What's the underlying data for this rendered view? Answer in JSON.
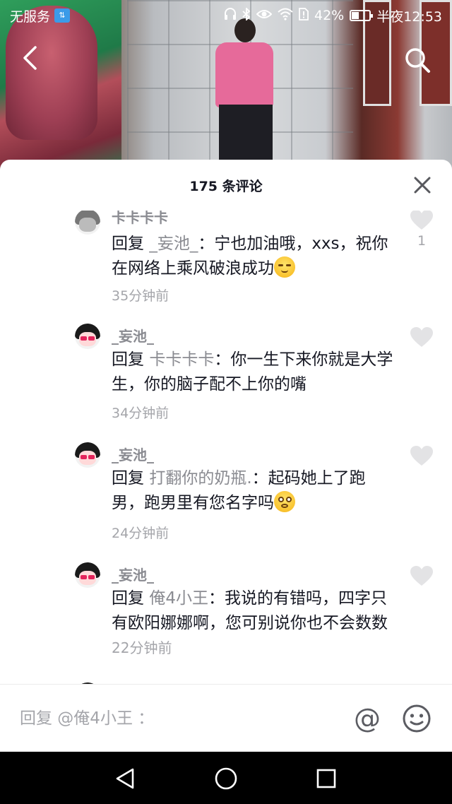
{
  "status_bar": {
    "carrier": "无服务",
    "battery_percent": "42%",
    "battery_level": 0.42,
    "time": "半夜12:53"
  },
  "sheet": {
    "title": "175 条评论"
  },
  "comments": [
    {
      "username": "卡卡卡卡",
      "reply_label": "回复",
      "mention": "_妄池_",
      "separator": "：",
      "text": "宁也加油哦，xxs，祝你在网络上乘风破浪成功",
      "emoji": "smirk-emoji",
      "time": "35分钟前",
      "like_count": "1"
    },
    {
      "username": "_妄池_",
      "reply_label": "回复",
      "mention": "卡卡卡卡",
      "separator": "：",
      "text": "你一生下来你就是大学生，你的脑子配不上你的嘴",
      "time": "34分钟前"
    },
    {
      "username": "_妄池_",
      "reply_label": "回复",
      "mention": "打翻你的奶瓶.",
      "separator": "：",
      "text": "起码她上了跑男，跑男里有您名字吗",
      "emoji": "surprised-emoji",
      "time": "24分钟前"
    },
    {
      "username": "_妄池_",
      "reply_label": "回复",
      "mention": "俺4小王",
      "separator": "：",
      "text": "我说的有错吗，四字只有欧阳娜娜啊，您可别说你也不会数数",
      "time": "22分钟前"
    }
  ],
  "input": {
    "placeholder": "回复 @俺4小王 ："
  },
  "icons": {
    "back": "back-arrow-icon",
    "search": "search-icon",
    "close": "close-icon",
    "like": "heart-icon",
    "at": "at-icon",
    "emoji": "emoji-icon",
    "nav_back": "triangle-back-icon",
    "nav_home": "circle-home-icon",
    "nav_recents": "square-recents-icon"
  }
}
